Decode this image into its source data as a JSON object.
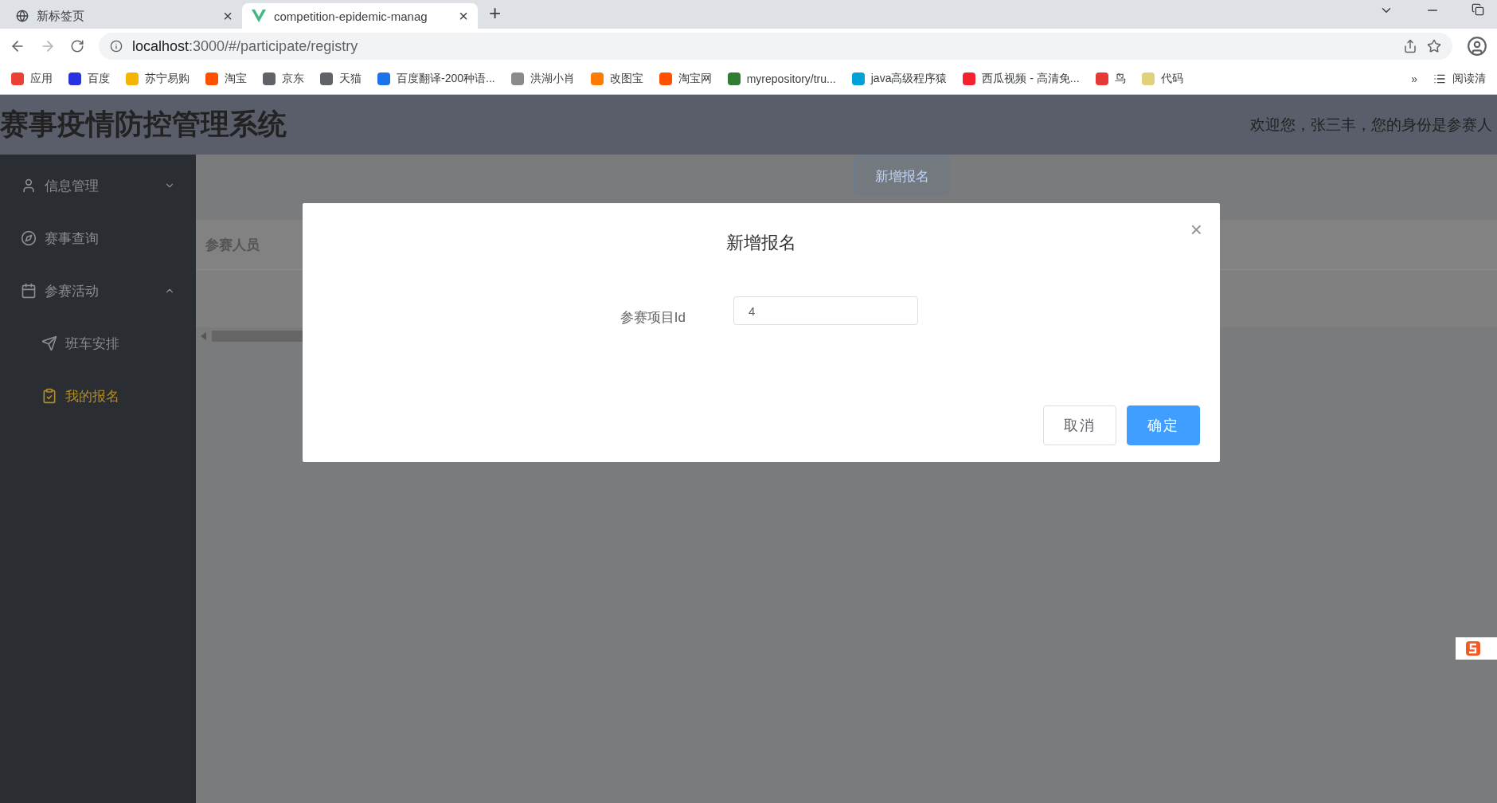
{
  "browser": {
    "tabs": [
      {
        "title": "新标签页",
        "selected": false,
        "close": "×"
      },
      {
        "title": "competition-epidemic-manag",
        "selected": true,
        "close": "×"
      }
    ],
    "new_tab": "+",
    "url_host": "localhost",
    "url_rest": ":3000/#/participate/registry",
    "bookmarks": [
      {
        "label": "应用",
        "color": "#e94235"
      },
      {
        "label": "百度",
        "color": "#2932e1"
      },
      {
        "label": "苏宁易购",
        "color": "#f5b400"
      },
      {
        "label": "淘宝",
        "color": "#ff5000"
      },
      {
        "label": "京东",
        "color": "#5f6368"
      },
      {
        "label": "天猫",
        "color": "#5f6368"
      },
      {
        "label": "百度翻译-200种语...",
        "color": "#1a73e8"
      },
      {
        "label": "洪湖小肖",
        "color": "#8a8a8a"
      },
      {
        "label": "改图宝",
        "color": "#ff7a00"
      },
      {
        "label": "淘宝网",
        "color": "#ff5000"
      },
      {
        "label": "myrepository/tru...",
        "color": "#2e7d32"
      },
      {
        "label": "java高级程序猿",
        "color": "#00a1d6"
      },
      {
        "label": "西瓜视频 - 高清免...",
        "color": "#f5222d"
      },
      {
        "label": "鸟",
        "color": "#e53935"
      },
      {
        "label": "代码",
        "color": "#e0d27a"
      }
    ],
    "more": "»",
    "reading_list": "阅读清"
  },
  "header": {
    "title": "赛事疫情防控管理系统",
    "welcome": "欢迎您，张三丰，您的身份是参赛人"
  },
  "sidebar": {
    "items": [
      {
        "label": "信息管理",
        "expanded": false,
        "selected": false
      },
      {
        "label": "赛事查询",
        "selected": false
      },
      {
        "label": "参赛活动",
        "expanded": true,
        "selected": false,
        "children": [
          {
            "label": "班车安排",
            "selected": false
          },
          {
            "label": "我的报名",
            "selected": true
          }
        ]
      }
    ]
  },
  "main": {
    "add_button": "新增报名",
    "table": {
      "columns": [
        "参赛人员"
      ]
    }
  },
  "dialog": {
    "title": "新增报名",
    "close": "×",
    "field_label": "参赛项目Id",
    "field_value": "4",
    "buttons": [
      {
        "label": "取消",
        "kind": "default"
      },
      {
        "label": "确定",
        "kind": "primary"
      }
    ]
  }
}
